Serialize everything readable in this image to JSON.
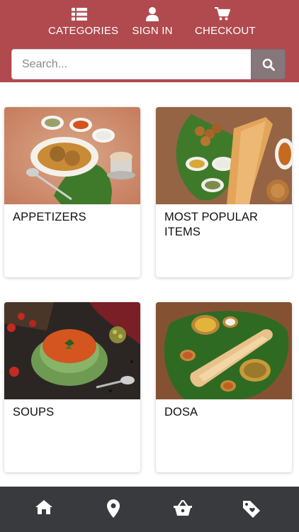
{
  "nav": {
    "categories_label": "CATEGORIES",
    "sign_in_label": "SIGN IN",
    "checkout_label": "CHECKOUT"
  },
  "search": {
    "placeholder": "Search...",
    "value": ""
  },
  "cards": [
    {
      "title": "APPETIZERS"
    },
    {
      "title": "MOST POPULAR ITEMS"
    },
    {
      "title": "SOUPS"
    },
    {
      "title": "DOSA"
    }
  ],
  "bottom_nav": {
    "items": [
      "home-icon",
      "location-pin-icon",
      "basket-icon",
      "tag-icon"
    ]
  },
  "colors": {
    "header": "#b04a4f",
    "search_button": "#85777a",
    "bottom_bar": "#383a3e"
  }
}
